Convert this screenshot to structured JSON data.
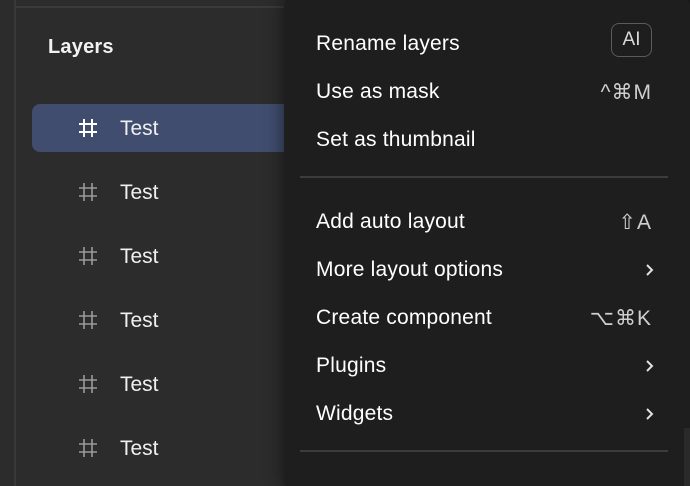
{
  "layers_panel": {
    "title": "Layers",
    "items": [
      {
        "name": "Test",
        "selected": true
      },
      {
        "name": "Test",
        "selected": false
      },
      {
        "name": "Test",
        "selected": false
      },
      {
        "name": "Test",
        "selected": false
      },
      {
        "name": "Test",
        "selected": false
      },
      {
        "name": "Test",
        "selected": false
      }
    ],
    "item_icon": "frame-icon"
  },
  "context_menu": {
    "rename_layers": {
      "label": "Rename layers",
      "badge": "AI"
    },
    "use_as_mask": {
      "label": "Use as mask",
      "shortcut": "^⌘M"
    },
    "set_as_thumbnail": {
      "label": "Set as thumbnail"
    },
    "add_auto_layout": {
      "label": "Add auto layout",
      "shortcut": "⇧A"
    },
    "more_layout_options": {
      "label": "More layout options",
      "submenu_icon": "chevron-right-icon"
    },
    "create_component": {
      "label": "Create component",
      "shortcut": "⌥⌘K"
    },
    "plugins": {
      "label": "Plugins",
      "submenu_icon": "chevron-right-icon"
    },
    "widgets": {
      "label": "Widgets",
      "submenu_icon": "chevron-right-icon"
    }
  },
  "colors": {
    "panel_bg": "#2c2c2c",
    "menu_bg": "#1e1e1e",
    "selected_row": "#404d6e",
    "separator": "#3c3c3c"
  }
}
